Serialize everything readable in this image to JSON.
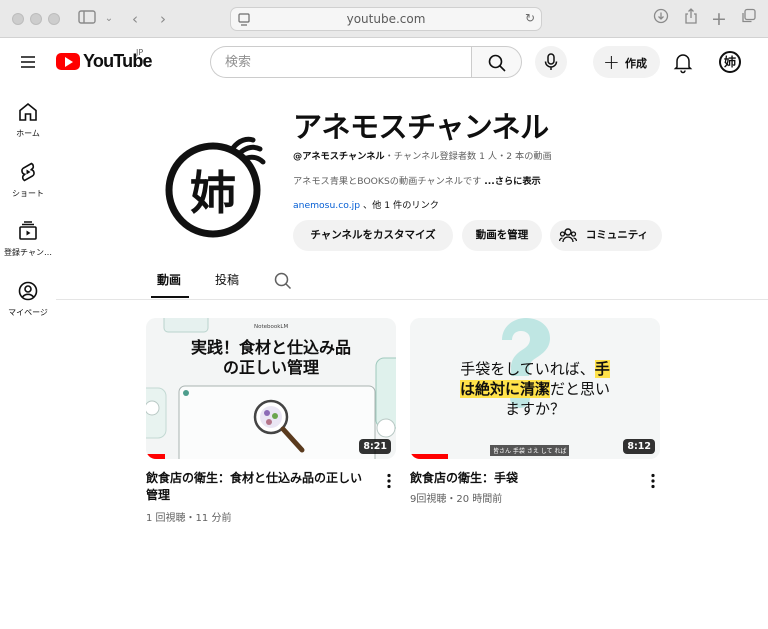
{
  "browser": {
    "url": "youtube.com"
  },
  "masthead": {
    "logo_text": "YouTube",
    "region": "JP",
    "search_placeholder": "検索",
    "create_label": "作成"
  },
  "guide": {
    "items": [
      {
        "label": "ホーム",
        "icon": "home-icon"
      },
      {
        "label": "ショート",
        "icon": "shorts-icon"
      },
      {
        "label": "登録チャン…",
        "icon": "subscriptions-icon"
      },
      {
        "label": "マイページ",
        "icon": "my-page-icon"
      }
    ]
  },
  "channel": {
    "name": "アネモスチャンネル",
    "handle": "@アネモスチャンネル",
    "subscribers": "・チャンネル登録者数 1 人・2 本の動画",
    "description": "アネモス青果とBOOKSの動画チャンネルです ",
    "more_label": "...さらに表示",
    "link": "anemosu.co.jp",
    "other_links": " 、他 1 件のリンク",
    "buttons": {
      "customize": "チャンネルをカスタマイズ",
      "manage": "動画を管理",
      "community": "コミュニティ"
    },
    "avatar_glyph": "姉"
  },
  "tabs": {
    "videos": "動画",
    "posts": "投稿"
  },
  "videos": [
    {
      "title": "飲食店の衛生：食材と仕込み品の正しい管理",
      "meta": "1 回視聴・11 分前",
      "duration": "8:21",
      "thumb_badge": "NotebookLM",
      "thumb_line1": "実践！食材と仕込み品",
      "thumb_line2": "の正しい管理"
    },
    {
      "title": "飲食店の衛生：手袋",
      "meta": "9回視聴・20 時間前",
      "duration": "8:12",
      "thumb_l1a": "手袋をしていれば、",
      "thumb_l1b": "手",
      "thumb_l2a": "は絶対に清潔",
      "thumb_l2b": "だと思い",
      "thumb_l3": "ますか？",
      "thumb_caption": "皆さん 手袋 さえ して れば"
    }
  ],
  "colors": {
    "brand_red": "#ff0000",
    "link_blue": "#065fd4",
    "highlight_yellow": "#ffe24a"
  }
}
